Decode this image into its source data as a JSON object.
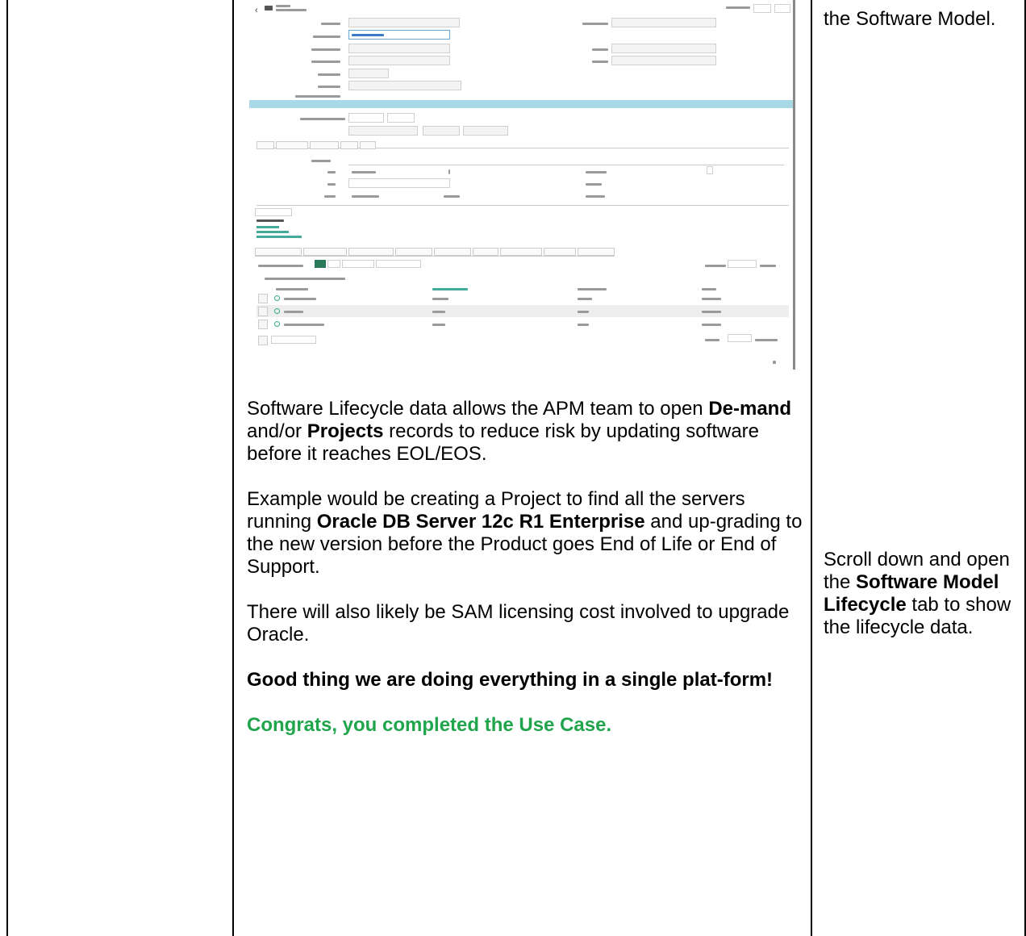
{
  "left_column": {
    "top_text": "the Software Model.",
    "instruction_parts": [
      "Scroll down and open the ",
      "Software Model Lifecycle",
      " tab to show the lifecycle data."
    ]
  },
  "main_column": {
    "para1_parts": [
      "Software Lifecycle data allows the APM team to open ",
      "De-mand",
      " and/or ",
      "Projects",
      " records to reduce risk by updating software before it reaches EOL/EOS."
    ],
    "para2_parts": [
      "Example would be creating a Project to find all the servers running ",
      "Oracle DB Server 12c R1 Enterprise",
      " and up-grading to the new version before the Product goes End of Life or End of Support."
    ],
    "para3": "There will also likely be SAM licensing cost involved to upgrade Oracle.",
    "para4": "Good thing we are doing everything in a single plat-form!",
    "para5": "Congrats, you completed the Use Case."
  },
  "colors": {
    "green": "#21a54c",
    "band": "#a9d8e6"
  },
  "screenshot": {
    "back_icon": "chevron-left-icon"
  }
}
